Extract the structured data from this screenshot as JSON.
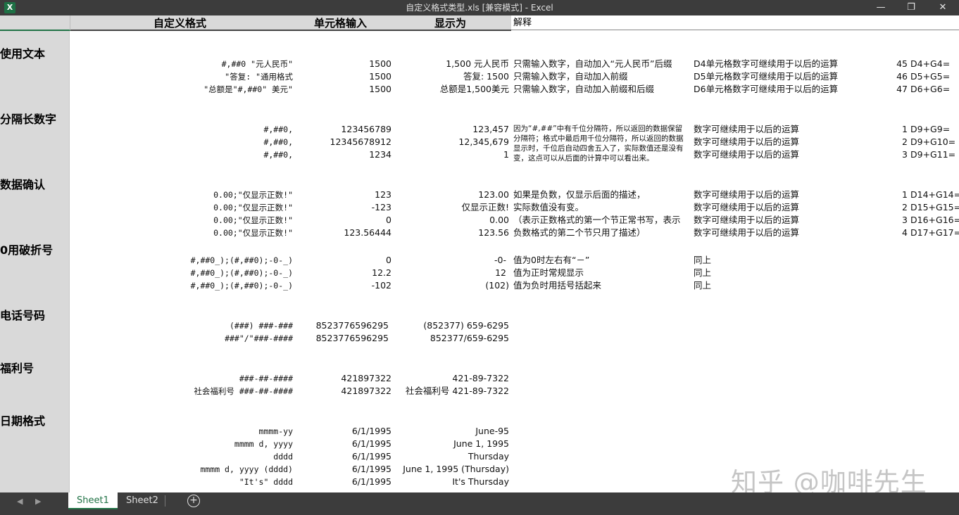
{
  "window": {
    "app_icon": "X",
    "title": "自定义格式类型.xls  [兼容模式] - Excel",
    "minimize": "—",
    "restore": "❐",
    "close": "✕"
  },
  "headers": {
    "format": "自定义格式",
    "input": "单元格输入",
    "display": "显示为",
    "explain": "解释"
  },
  "sections": [
    {
      "title": "使用文本",
      "rows": [
        {
          "format": "#,##0 \"元人民币\"",
          "input": "1500",
          "display": "1,500 元人民币",
          "explain": "只需输入数字，自动加入“元人民币”后缀",
          "note": "D4单元格数字可继续用于以后的运算",
          "num": "45",
          "formula": "D4+G4="
        },
        {
          "format": "\"答复: \"通用格式",
          "input": "1500",
          "display": "答复: 1500",
          "explain": "只需输入数字，自动加入前缀",
          "note": "D5单元格数字可继续用于以后的运算",
          "num": "46",
          "formula": "D5+G5="
        },
        {
          "format": "\"总额是\"#,##0\" 美元\"",
          "input": "1500",
          "display": "总额是1,500美元",
          "explain": "只需输入数字，自动加入前缀和后缀",
          "note": "D6单元格数字可继续用于以后的运算",
          "num": "47",
          "formula": "D6+G6="
        }
      ]
    },
    {
      "title": "分隔长数字",
      "rows": [
        {
          "format": "#,##0,",
          "input": "123456789",
          "display": "123,457",
          "note": "数字可继续用于以后的运算",
          "num": "1",
          "formula": "D9+G9="
        },
        {
          "format": "#,##0,",
          "input": "12345678912",
          "display": "12,345,679",
          "note": "数字可继续用于以后的运算",
          "num": "2",
          "formula": "D9+G10="
        },
        {
          "format": "#,##0,",
          "input": "1234",
          "display": "1",
          "note": "数字可继续用于以后的运算",
          "num": "3",
          "formula": "D9+G11="
        }
      ],
      "explain_block": "因为“#,##”中有千位分隔符，所以返回的数据保留分隔符；格式中最后用千位分隔符，所以返回的数据显示时，千位后自动四舍五入了，实际数值还是没有变，这点可以从后面的计算中可以看出来。"
    },
    {
      "title": "数据确认",
      "rows": [
        {
          "format": "0.00;\"仅显示正数!\"",
          "input": "123",
          "display": "123.00",
          "explain": "如果是负数，仅显示后面的描述，",
          "note": "数字可继续用于以后的运算",
          "num": "1",
          "formula": "D14+G14="
        },
        {
          "format": "0.00;\"仅显示正数!\"",
          "input": "-123",
          "display": "仅显示正数!",
          "explain": "实际数值没有变。",
          "note": "数字可继续用于以后的运算",
          "num": "2",
          "formula": "D15+G15="
        },
        {
          "format": "0.00;\"仅显示正数!\"",
          "input": "0",
          "display": "0.00",
          "explain": "（表示正数格式的第一个节正常书写，表示",
          "note": "数字可继续用于以后的运算",
          "num": "3",
          "formula": "D16+G16="
        },
        {
          "format": "0.00;\"仅显示正数!\"",
          "input": "123.56444",
          "display": "123.56",
          "explain": "负数格式的第二个节只用了描述）",
          "note": "数字可继续用于以后的运算",
          "num": "4",
          "formula": "D17+G17="
        }
      ]
    },
    {
      "title": "0用破折号",
      "rows": [
        {
          "format": "#,##0_);(#,##0);-0-_)",
          "input": "0",
          "display": "-0-",
          "explain": "值为0时左右有“－”",
          "note": "同上"
        },
        {
          "format": "#,##0_);(#,##0);-0-_)",
          "input": "12.2",
          "display": "12",
          "explain": "值为正时常规显示",
          "note": "同上"
        },
        {
          "format": "#,##0_);(#,##0);-0-_)",
          "input": "-102",
          "display": "(102)",
          "explain": "值为负时用括号括起来",
          "note": "同上"
        }
      ]
    },
    {
      "title": "电话号码",
      "rows": [
        {
          "format": "(###) ###-###",
          "input": "8523776596295",
          "display": "(852377) 659-6295"
        },
        {
          "format": "###\"/\"###-####",
          "input": "8523776596295",
          "display": "852377/659-6295"
        }
      ]
    },
    {
      "title": "福利号",
      "rows": [
        {
          "format": "###-##-####",
          "input": "421897322",
          "display": "421-89-7322"
        },
        {
          "format": "社会福利号 ###-##-####",
          "input": "421897322",
          "display": "社会福利号 421-89-7322"
        }
      ]
    },
    {
      "title": "日期格式",
      "rows": [
        {
          "format": "mmmm-yy",
          "input": "6/1/1995",
          "display": "June-95"
        },
        {
          "format": "mmmm d, yyyy",
          "input": "6/1/1995",
          "display": "June 1, 1995"
        },
        {
          "format": "dddd",
          "input": "6/1/1995",
          "display": "Thursday"
        },
        {
          "format": "mmmm d, yyyy (dddd)",
          "input": "6/1/1995",
          "display": "June 1, 1995 (Thursday)"
        },
        {
          "format": "\"It's\" dddd",
          "input": "6/1/1995",
          "display": "It's Thursday"
        }
      ]
    }
  ],
  "watermark": "知乎 @咖啡先生",
  "tabs": {
    "nav_prev": "◀",
    "nav_next": "▶",
    "sheet1": "Sheet1",
    "sheet2": "Sheet2",
    "add": "+"
  }
}
